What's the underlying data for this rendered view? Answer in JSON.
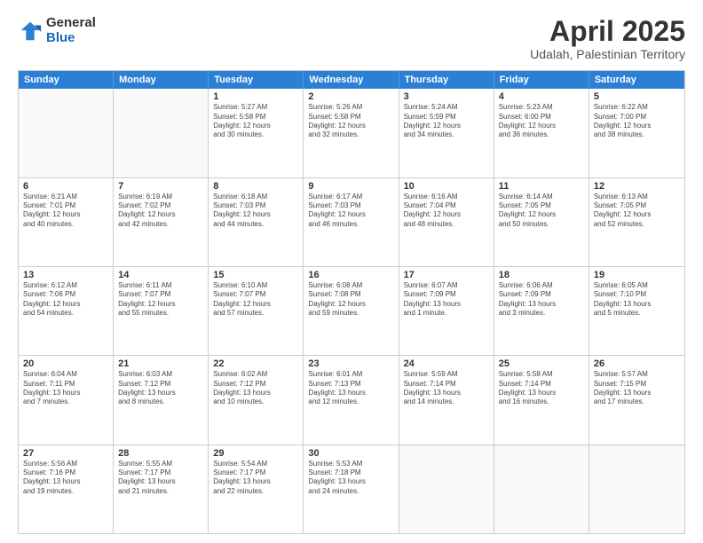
{
  "logo": {
    "general": "General",
    "blue": "Blue"
  },
  "title": "April 2025",
  "subtitle": "Udalah, Palestinian Territory",
  "days": [
    "Sunday",
    "Monday",
    "Tuesday",
    "Wednesday",
    "Thursday",
    "Friday",
    "Saturday"
  ],
  "rows": [
    [
      {
        "num": "",
        "lines": []
      },
      {
        "num": "",
        "lines": []
      },
      {
        "num": "1",
        "lines": [
          "Sunrise: 5:27 AM",
          "Sunset: 5:58 PM",
          "Daylight: 12 hours",
          "and 30 minutes."
        ]
      },
      {
        "num": "2",
        "lines": [
          "Sunrise: 5:26 AM",
          "Sunset: 5:58 PM",
          "Daylight: 12 hours",
          "and 32 minutes."
        ]
      },
      {
        "num": "3",
        "lines": [
          "Sunrise: 5:24 AM",
          "Sunset: 5:59 PM",
          "Daylight: 12 hours",
          "and 34 minutes."
        ]
      },
      {
        "num": "4",
        "lines": [
          "Sunrise: 5:23 AM",
          "Sunset: 6:00 PM",
          "Daylight: 12 hours",
          "and 36 minutes."
        ]
      },
      {
        "num": "5",
        "lines": [
          "Sunrise: 6:22 AM",
          "Sunset: 7:00 PM",
          "Daylight: 12 hours",
          "and 38 minutes."
        ]
      }
    ],
    [
      {
        "num": "6",
        "lines": [
          "Sunrise: 6:21 AM",
          "Sunset: 7:01 PM",
          "Daylight: 12 hours",
          "and 40 minutes."
        ]
      },
      {
        "num": "7",
        "lines": [
          "Sunrise: 6:19 AM",
          "Sunset: 7:02 PM",
          "Daylight: 12 hours",
          "and 42 minutes."
        ]
      },
      {
        "num": "8",
        "lines": [
          "Sunrise: 6:18 AM",
          "Sunset: 7:03 PM",
          "Daylight: 12 hours",
          "and 44 minutes."
        ]
      },
      {
        "num": "9",
        "lines": [
          "Sunrise: 6:17 AM",
          "Sunset: 7:03 PM",
          "Daylight: 12 hours",
          "and 46 minutes."
        ]
      },
      {
        "num": "10",
        "lines": [
          "Sunrise: 6:16 AM",
          "Sunset: 7:04 PM",
          "Daylight: 12 hours",
          "and 48 minutes."
        ]
      },
      {
        "num": "11",
        "lines": [
          "Sunrise: 6:14 AM",
          "Sunset: 7:05 PM",
          "Daylight: 12 hours",
          "and 50 minutes."
        ]
      },
      {
        "num": "12",
        "lines": [
          "Sunrise: 6:13 AM",
          "Sunset: 7:05 PM",
          "Daylight: 12 hours",
          "and 52 minutes."
        ]
      }
    ],
    [
      {
        "num": "13",
        "lines": [
          "Sunrise: 6:12 AM",
          "Sunset: 7:06 PM",
          "Daylight: 12 hours",
          "and 54 minutes."
        ]
      },
      {
        "num": "14",
        "lines": [
          "Sunrise: 6:11 AM",
          "Sunset: 7:07 PM",
          "Daylight: 12 hours",
          "and 55 minutes."
        ]
      },
      {
        "num": "15",
        "lines": [
          "Sunrise: 6:10 AM",
          "Sunset: 7:07 PM",
          "Daylight: 12 hours",
          "and 57 minutes."
        ]
      },
      {
        "num": "16",
        "lines": [
          "Sunrise: 6:08 AM",
          "Sunset: 7:08 PM",
          "Daylight: 12 hours",
          "and 59 minutes."
        ]
      },
      {
        "num": "17",
        "lines": [
          "Sunrise: 6:07 AM",
          "Sunset: 7:09 PM",
          "Daylight: 13 hours",
          "and 1 minute."
        ]
      },
      {
        "num": "18",
        "lines": [
          "Sunrise: 6:06 AM",
          "Sunset: 7:09 PM",
          "Daylight: 13 hours",
          "and 3 minutes."
        ]
      },
      {
        "num": "19",
        "lines": [
          "Sunrise: 6:05 AM",
          "Sunset: 7:10 PM",
          "Daylight: 13 hours",
          "and 5 minutes."
        ]
      }
    ],
    [
      {
        "num": "20",
        "lines": [
          "Sunrise: 6:04 AM",
          "Sunset: 7:11 PM",
          "Daylight: 13 hours",
          "and 7 minutes."
        ]
      },
      {
        "num": "21",
        "lines": [
          "Sunrise: 6:03 AM",
          "Sunset: 7:12 PM",
          "Daylight: 13 hours",
          "and 8 minutes."
        ]
      },
      {
        "num": "22",
        "lines": [
          "Sunrise: 6:02 AM",
          "Sunset: 7:12 PM",
          "Daylight: 13 hours",
          "and 10 minutes."
        ]
      },
      {
        "num": "23",
        "lines": [
          "Sunrise: 6:01 AM",
          "Sunset: 7:13 PM",
          "Daylight: 13 hours",
          "and 12 minutes."
        ]
      },
      {
        "num": "24",
        "lines": [
          "Sunrise: 5:59 AM",
          "Sunset: 7:14 PM",
          "Daylight: 13 hours",
          "and 14 minutes."
        ]
      },
      {
        "num": "25",
        "lines": [
          "Sunrise: 5:58 AM",
          "Sunset: 7:14 PM",
          "Daylight: 13 hours",
          "and 16 minutes."
        ]
      },
      {
        "num": "26",
        "lines": [
          "Sunrise: 5:57 AM",
          "Sunset: 7:15 PM",
          "Daylight: 13 hours",
          "and 17 minutes."
        ]
      }
    ],
    [
      {
        "num": "27",
        "lines": [
          "Sunrise: 5:56 AM",
          "Sunset: 7:16 PM",
          "Daylight: 13 hours",
          "and 19 minutes."
        ]
      },
      {
        "num": "28",
        "lines": [
          "Sunrise: 5:55 AM",
          "Sunset: 7:17 PM",
          "Daylight: 13 hours",
          "and 21 minutes."
        ]
      },
      {
        "num": "29",
        "lines": [
          "Sunrise: 5:54 AM",
          "Sunset: 7:17 PM",
          "Daylight: 13 hours",
          "and 22 minutes."
        ]
      },
      {
        "num": "30",
        "lines": [
          "Sunrise: 5:53 AM",
          "Sunset: 7:18 PM",
          "Daylight: 13 hours",
          "and 24 minutes."
        ]
      },
      {
        "num": "",
        "lines": []
      },
      {
        "num": "",
        "lines": []
      },
      {
        "num": "",
        "lines": []
      }
    ]
  ]
}
